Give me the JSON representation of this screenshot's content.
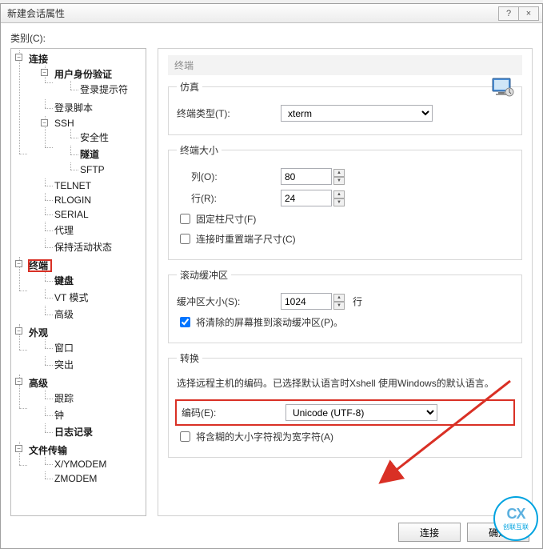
{
  "window": {
    "title": "新建会话属性"
  },
  "titlebar": {
    "help": "?",
    "close": "×"
  },
  "category_label": "类别(C):",
  "tree": {
    "connection": "连接",
    "auth": "用户身份验证",
    "login_prompt": "登录提示符",
    "login_script": "登录脚本",
    "ssh": "SSH",
    "security": "安全性",
    "tunnel": "隧道",
    "sftp": "SFTP",
    "telnet": "TELNET",
    "rlogin": "RLOGIN",
    "serial": "SERIAL",
    "proxy": "代理",
    "keepalive": "保持活动状态",
    "terminal": "终端",
    "keyboard": "键盘",
    "vt_mode": "VT 模式",
    "advanced": "高级",
    "appearance": "外观",
    "window": "窗口",
    "highlight": "突出",
    "advanced2": "高级",
    "trace": "跟踪",
    "bell": "钟",
    "logging": "日志记录",
    "file_transfer": "文件传输",
    "xymodem": "X/YMODEM",
    "zmodem": "ZMODEM"
  },
  "panel": {
    "header": "终端",
    "emulation_legend": "仿真",
    "term_type_label": "终端类型(T):",
    "term_type_value": "xterm",
    "size_legend": "终端大小",
    "cols_label": "列(O):",
    "cols_value": "80",
    "rows_label": "行(R):",
    "rows_value": "24",
    "fixed_cols_label": "固定柱尺寸(F)",
    "reset_on_connect_label": "连接时重置端子尺寸(C)",
    "scrollback_legend": "滚动缓冲区",
    "buffer_size_label": "缓冲区大小(S):",
    "buffer_size_value": "1024",
    "buffer_size_unit": "行",
    "push_cleared_label": "将清除的屏幕推到滚动缓冲区(P)。",
    "conversion_legend": "转换",
    "conversion_desc": "选择远程主机的编码。已选择默认语言时Xshell 使用Windows的默认语言。",
    "encoding_label": "编码(E):",
    "encoding_value": "Unicode (UTF-8)",
    "ambiguous_wide_label": "将含糊的大小字符视为宽字符(A)"
  },
  "footer": {
    "connect": "连接",
    "ok": "确定"
  },
  "logo": {
    "main": "CX",
    "sub": "创联互联"
  }
}
